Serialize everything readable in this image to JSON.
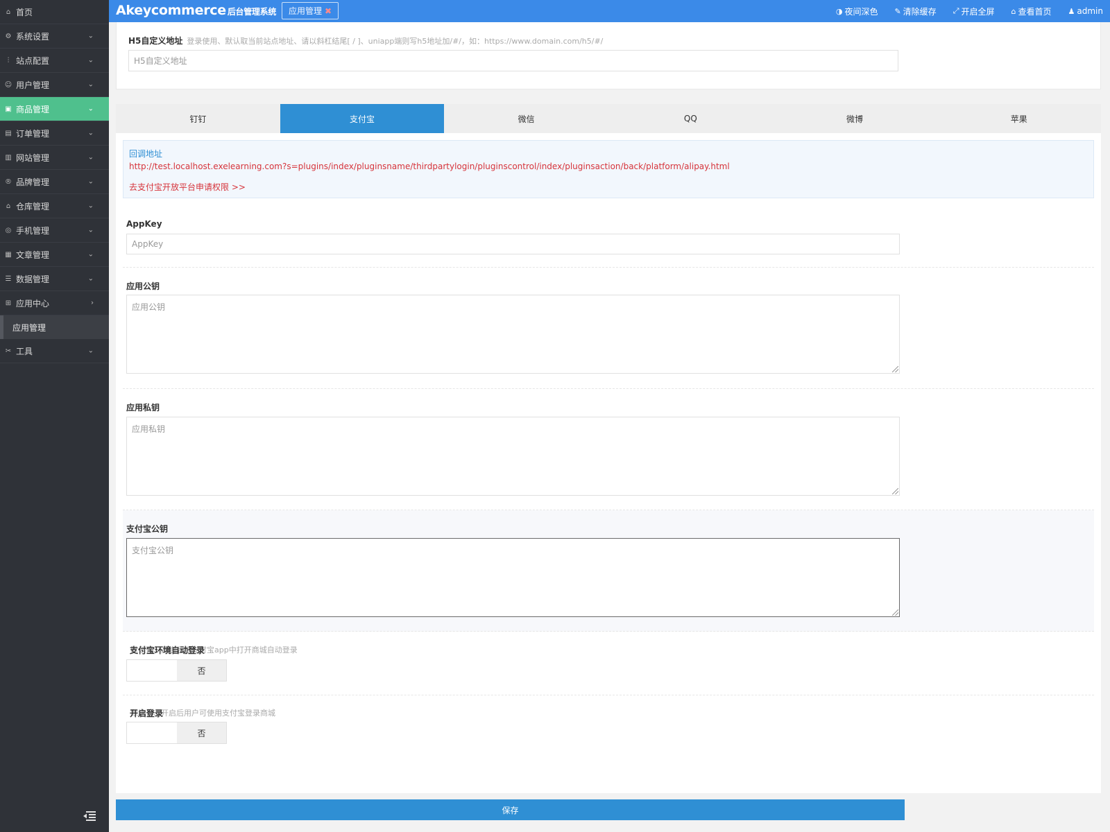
{
  "sidebar": {
    "items": [
      {
        "label": "首页",
        "icon": "home-icon",
        "glyph": "⌂",
        "arrow": ""
      },
      {
        "label": "系统设置",
        "icon": "gear-icon",
        "glyph": "⚙",
        "arrow": "⌄"
      },
      {
        "label": "站点配置",
        "icon": "sliders-icon",
        "glyph": "⫶",
        "arrow": "⌄"
      },
      {
        "label": "用户管理",
        "icon": "user-icon",
        "glyph": "☺",
        "arrow": "⌄"
      },
      {
        "label": "商品管理",
        "icon": "goods-icon",
        "glyph": "▣",
        "arrow": "⌄",
        "active": true
      },
      {
        "label": "订单管理",
        "icon": "order-icon",
        "glyph": "▤",
        "arrow": "⌄"
      },
      {
        "label": "网站管理",
        "icon": "website-icon",
        "glyph": "▥",
        "arrow": "⌄"
      },
      {
        "label": "品牌管理",
        "icon": "brand-icon",
        "glyph": "®",
        "arrow": "⌄"
      },
      {
        "label": "仓库管理",
        "icon": "warehouse-icon",
        "glyph": "⌂",
        "arrow": "⌄"
      },
      {
        "label": "手机管理",
        "icon": "mobile-icon",
        "glyph": "◎",
        "arrow": "⌄"
      },
      {
        "label": "文章管理",
        "icon": "article-icon",
        "glyph": "▦",
        "arrow": "⌄"
      },
      {
        "label": "数据管理",
        "icon": "database-icon",
        "glyph": "☰",
        "arrow": "⌄"
      },
      {
        "label": "应用中心",
        "icon": "apps-icon",
        "glyph": "⊞",
        "arrow": "›"
      }
    ],
    "sub_item": "应用管理",
    "tools": {
      "label": "工具",
      "icon": "tools-icon",
      "glyph": "✂",
      "arrow": "⌄"
    }
  },
  "header": {
    "brand": "Akeycommerce",
    "brand_sub": "后台管理系统",
    "open_tab": "应用管理",
    "open_tab_close": "✖",
    "actions": [
      {
        "label": "夜间深色",
        "icon": "contrast-icon",
        "glyph": "◑"
      },
      {
        "label": "清除缓存",
        "icon": "brush-icon",
        "glyph": "✎"
      },
      {
        "label": "开启全屏",
        "icon": "fullscreen-icon",
        "glyph": "⤢"
      },
      {
        "label": "查看首页",
        "icon": "home-icon",
        "glyph": "⌂"
      },
      {
        "label": "admin",
        "icon": "user-icon",
        "glyph": "♟"
      }
    ]
  },
  "h5": {
    "label": "H5自定义地址",
    "hint": "登录使用、默认取当前站点地址、请以斜杠结尾[ / ]、uniapp端则写h5地址加/#/，如：https://www.domain.com/h5/#/",
    "placeholder": "H5自定义地址"
  },
  "platform_tabs": [
    "钉钉",
    "支付宝",
    "微信",
    "QQ",
    "微博",
    "苹果"
  ],
  "active_tab": "支付宝",
  "callout": {
    "title": "回调地址",
    "url": "http://test.localhost.exelearning.com?s=plugins/index/pluginsname/thirdpartylogin/pluginscontrol/index/pluginsaction/back/platform/alipay.html",
    "link": "去支付宝开放平台申请权限 >>"
  },
  "fields": {
    "appkey": {
      "label": "AppKey",
      "placeholder": "AppKey"
    },
    "app_public_key": {
      "label": "应用公钥",
      "placeholder": "应用公钥"
    },
    "app_private_key": {
      "label": "应用私钥",
      "placeholder": "应用私钥"
    },
    "alipay_public_key": {
      "label": "支付宝公钥",
      "placeholder": "支付宝公钥"
    },
    "alipay_auto_login": {
      "label": "支付宝环境自动登录",
      "hint": "默认否、开启后在支付宝app中打开商城自动登录",
      "value": "否"
    },
    "enable_login": {
      "label": "开启登录",
      "hint": "默认否、开启后用户可使用支付宝登录商城",
      "value": "否"
    }
  },
  "save_label": "保存"
}
